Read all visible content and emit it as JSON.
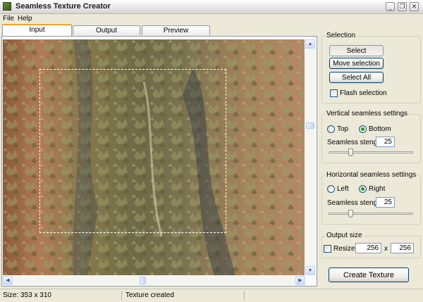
{
  "window": {
    "title": "Seamless Texture Creator",
    "controls": {
      "minimize": "_",
      "maximize": "❐",
      "close": "✕"
    }
  },
  "menu": [
    {
      "label": "File"
    },
    {
      "label": "Help"
    }
  ],
  "tabs": [
    {
      "label": "Input",
      "active": true
    },
    {
      "label": "Output",
      "active": false
    },
    {
      "label": "Preview",
      "active": false
    }
  ],
  "selection": {
    "title": "Selection",
    "select_label": "Select",
    "move_label": "Move selection",
    "select_all_label": "Select All",
    "flash_label": "Flash selection",
    "flash_checked": false
  },
  "vertical": {
    "title": "Vertical seamless settings",
    "top_label": "Top",
    "bottom_label": "Bottom",
    "selected": "Bottom",
    "strength_label": "Seamless stength:",
    "strength_value": "25",
    "slider_fraction": 0.25
  },
  "horizontal": {
    "title": "Horizontal seamless settings",
    "left_label": "Left",
    "right_label": "Right",
    "selected": "Right",
    "strength_label": "Seamless stength:",
    "strength_value": "25",
    "slider_fraction": 0.25
  },
  "output": {
    "title": "Output size",
    "resize_label": "Resize:",
    "resize_checked": false,
    "width": "256",
    "times": "x",
    "height": "256"
  },
  "create_label": "Create Texture",
  "status": {
    "size": "Size: 353 x 310",
    "message": "Texture created"
  },
  "colors": {
    "window_bg": "#ece9d8",
    "button_border": "#003c74",
    "tab_accent": "#f5a623",
    "radio_dot": "#21a121"
  }
}
